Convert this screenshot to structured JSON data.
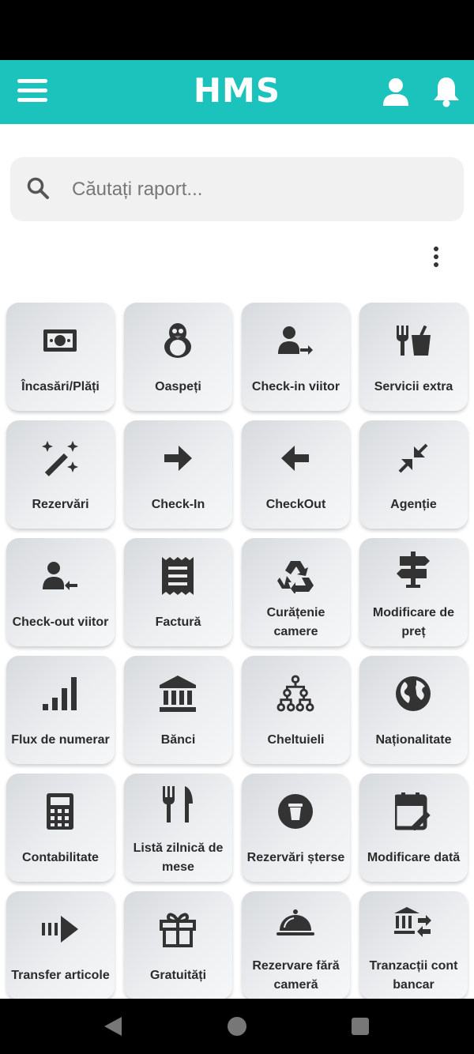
{
  "app": {
    "title": "HMS"
  },
  "search": {
    "placeholder": "Căutați raport..."
  },
  "tiles": [
    {
      "label": "Încasări/Plăți",
      "icon": "money-icon"
    },
    {
      "label": "Oaspeți",
      "icon": "penguin-icon"
    },
    {
      "label": "Check-in viitor",
      "icon": "user-arrow-right-icon"
    },
    {
      "label": "Servicii extra",
      "icon": "fork-drink-icon"
    },
    {
      "label": "Rezervări",
      "icon": "magic-wand-icon"
    },
    {
      "label": "Check-In",
      "icon": "arrow-right-icon"
    },
    {
      "label": "CheckOut",
      "icon": "arrow-left-icon"
    },
    {
      "label": "Agenție",
      "icon": "collapse-arrows-icon"
    },
    {
      "label": "Check-out viitor",
      "icon": "user-arrow-left-icon"
    },
    {
      "label": "Factură",
      "icon": "receipt-icon"
    },
    {
      "label": "Curățenie camere",
      "icon": "recycle-icon"
    },
    {
      "label": "Modificare de preț",
      "icon": "signpost-icon"
    },
    {
      "label": "Flux de numerar",
      "icon": "signal-bars-icon"
    },
    {
      "label": "Bănci",
      "icon": "bank-icon"
    },
    {
      "label": "Cheltuieli",
      "icon": "hierarchy-icon"
    },
    {
      "label": "Naționalitate",
      "icon": "globe-icon"
    },
    {
      "label": "Contabilitate",
      "icon": "calculator-icon"
    },
    {
      "label": "Listă zilnică de mese",
      "icon": "fork-knife-icon"
    },
    {
      "label": "Rezervări șterse",
      "icon": "trash-circle-icon"
    },
    {
      "label": "Modificare dată",
      "icon": "calendar-edit-icon"
    },
    {
      "label": "Transfer articole",
      "icon": "transfer-arrow-icon"
    },
    {
      "label": "Gratuități",
      "icon": "gift-icon"
    },
    {
      "label": "Rezervare fără cameră",
      "icon": "room-service-icon"
    },
    {
      "label": "Tranzacții cont bancar",
      "icon": "bank-transfer-icon"
    }
  ]
}
